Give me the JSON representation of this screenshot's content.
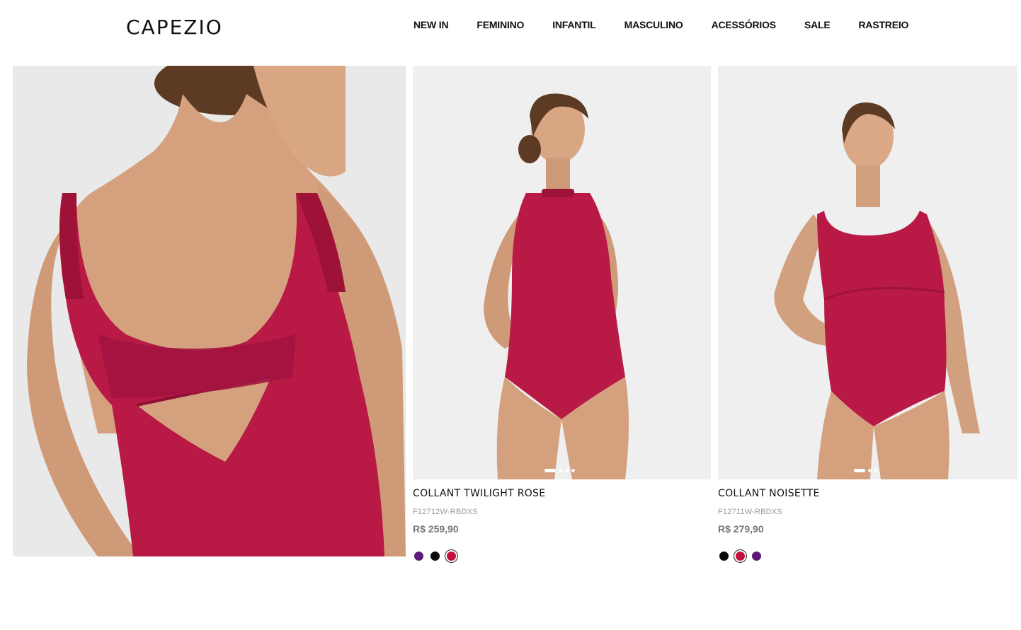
{
  "brand": {
    "logo": "CAPEZIO"
  },
  "nav": [
    {
      "label": "NEW IN"
    },
    {
      "label": "FEMININO"
    },
    {
      "label": "INFANTIL"
    },
    {
      "label": "MASCULINO"
    },
    {
      "label": "ACESSÓRIOS"
    },
    {
      "label": "SALE"
    },
    {
      "label": "RASTREIO"
    }
  ],
  "colors": {
    "leotard": "#b81945",
    "background": "#efefef",
    "skin": "#d9a684"
  },
  "products": [
    {
      "name": "COLLANT TWILIGHT ROSE",
      "sku": "F12712W-RBDXS",
      "price": "R$ 259,90",
      "image_count": 4,
      "active_image": 1,
      "swatches": [
        {
          "name": "purple",
          "color": "#5b1a7a",
          "selected": false
        },
        {
          "name": "black",
          "color": "#0a0a0a",
          "selected": false
        },
        {
          "name": "red",
          "color": "#c4103c",
          "selected": true
        }
      ]
    },
    {
      "name": "COLLANT NOISETTE",
      "sku": "F12711W-RBDXS",
      "price": "R$ 279,90",
      "image_count": 3,
      "active_image": 1,
      "swatches": [
        {
          "name": "black",
          "color": "#0a0a0a",
          "selected": false
        },
        {
          "name": "red",
          "color": "#c4103c",
          "selected": true
        },
        {
          "name": "purple",
          "color": "#5b1a7a",
          "selected": false
        }
      ]
    }
  ]
}
